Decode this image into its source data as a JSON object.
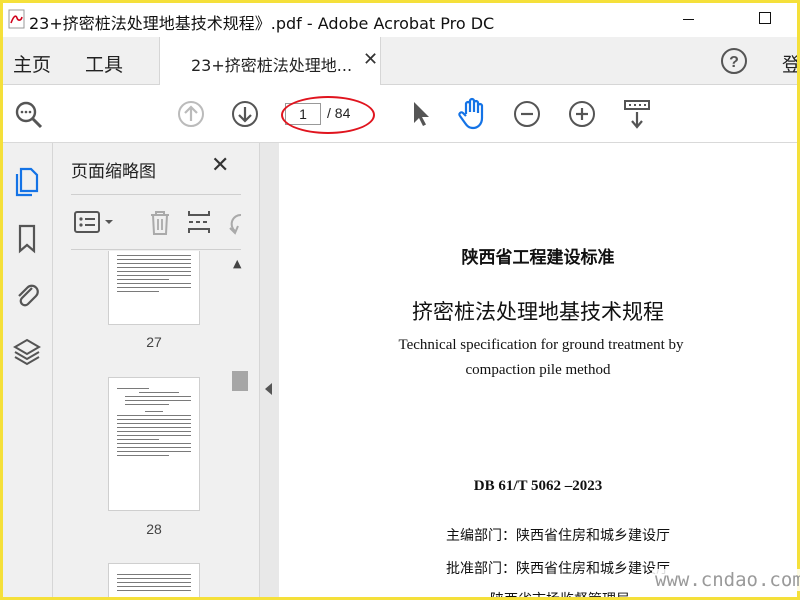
{
  "window": {
    "title": "23+挤密桩法处理地基技术规程》.pdf - Adobe Acrobat Pro DC",
    "frame_color": "#f5e03a"
  },
  "menu": {
    "home": "主页",
    "tools": "工具",
    "doc_tab": "23+挤密桩法处理地...",
    "login": "登"
  },
  "toolbar": {
    "current_page": "1",
    "total_pages": "/ 84",
    "highlight_color": "#e0141e",
    "active_color": "#1473e6"
  },
  "thumbnails": {
    "title": "页面缩略图",
    "pages": [
      {
        "number": "27"
      },
      {
        "number": "28"
      }
    ]
  },
  "document": {
    "standard_category": "陕西省工程建设标准",
    "title_cn": "挤密桩法处理地基技术规程",
    "title_en_line1": "Technical specification for ground treatment by",
    "title_en_line2": "compaction pile method",
    "standard_code": "DB 61/T  5062 –2023",
    "editor_dept": "主编部门：陕西省住房和城乡建设厅",
    "approval_dept": "批准部门：陕西省住房和城乡建设厅",
    "cut_line": "陕西省市场监督管理局"
  },
  "watermark": "www.cndao.com"
}
